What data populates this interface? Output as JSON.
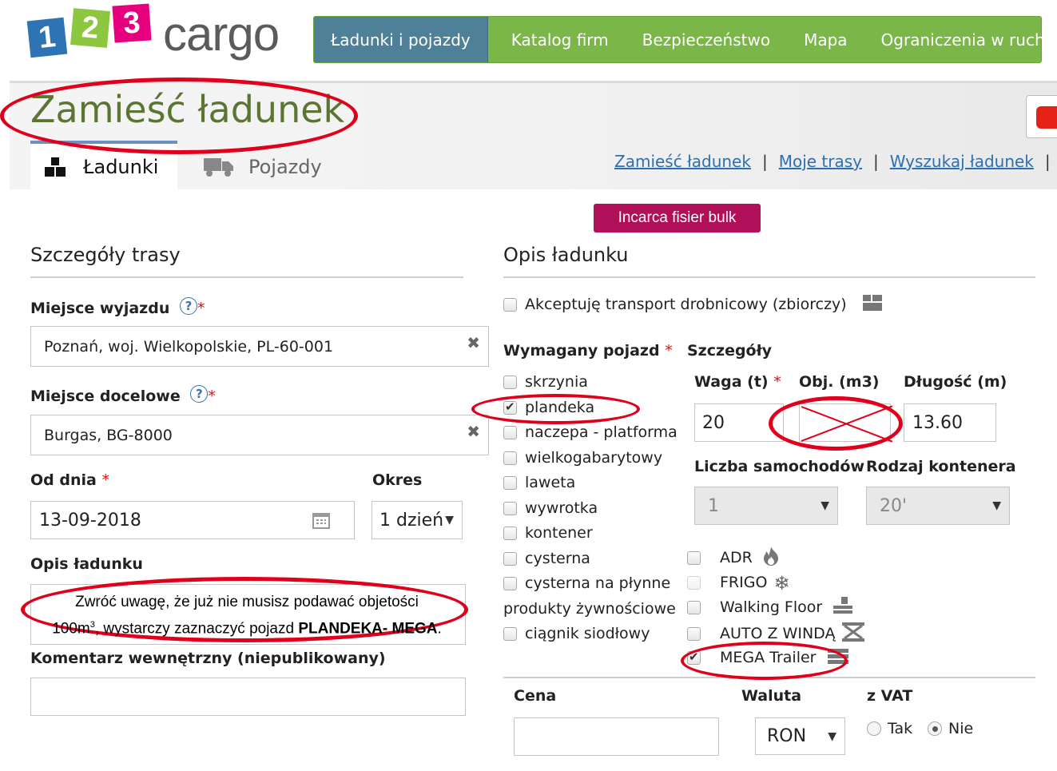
{
  "logo": {
    "digits": [
      "1",
      "2",
      "3"
    ],
    "word": "cargo",
    "colors": [
      "#2e74b5",
      "#8dc63f",
      "#e6007e"
    ]
  },
  "nav": {
    "items": [
      "Ładunki i pojazdy",
      "Katalog firm",
      "Bezpieczeństwo",
      "Mapa",
      "Ograniczenia w ruchu"
    ],
    "active_index": 0,
    "bar_color": "#7ab648",
    "active_color": "#4e8097"
  },
  "page": {
    "title": "Zamieść ładunek",
    "tabs": [
      {
        "label": "Ładunki",
        "icon": "boxes-icon",
        "active": true
      },
      {
        "label": "Pojazdy",
        "icon": "truck-icon",
        "active": false
      }
    ],
    "links": [
      "Zamieść ładunek",
      "Moje trasy",
      "Wyszukaj ładunek"
    ],
    "link_separator": "|",
    "bulk_button": "Incarca fisier bulk"
  },
  "route": {
    "title": "Szczegóły trasy",
    "from": {
      "label": "Miejsce wyjazdu",
      "value": "Poznań, woj. Wielkopolskie, PL-60-001"
    },
    "to": {
      "label": "Miejsce docelowe",
      "value": "Burgas, BG-8000"
    },
    "date": {
      "label": "Od dnia",
      "value": "13-09-2018"
    },
    "period": {
      "label": "Okres",
      "value": "1 dzień"
    },
    "description": {
      "label": "Opis ładunku",
      "value": ""
    },
    "comment": {
      "label": "Komentarz wewnętrzny (niepublikowany)",
      "value": ""
    },
    "help_glyph": "?",
    "required_mark": "*",
    "clear_glyph": "✖"
  },
  "cargo": {
    "title": "Opis ładunku",
    "groupage": {
      "label": "Akceptuję transport drobnicowy (zbiorczy)",
      "checked": false
    },
    "vehicle": {
      "label": "Wymagany pojazd",
      "types": [
        {
          "label": "skrzynia",
          "checked": false
        },
        {
          "label": "plandeka",
          "checked": true
        },
        {
          "label": "naczepa - platforma",
          "checked": false
        },
        {
          "label": "wielkogabarytowy",
          "checked": false
        },
        {
          "label": "laweta",
          "checked": false
        },
        {
          "label": "wywrotka",
          "checked": false
        },
        {
          "label": "kontener",
          "checked": false
        },
        {
          "label": "cysterna",
          "checked": false
        },
        {
          "label": "cysterna na płynne",
          "checked": false
        },
        {
          "label": "produkty żywnościowe",
          "checked": false
        },
        {
          "label": "ciągnik siodłowy",
          "checked": false
        }
      ]
    },
    "details": {
      "label": "Szczegóły",
      "weight": {
        "label": "Waga (t)",
        "value": "20"
      },
      "volume": {
        "label": "Obj. (m3)",
        "value": ""
      },
      "length": {
        "label": "Długość (m)",
        "value": "13.60"
      },
      "trucks": {
        "label": "Liczba samochodów",
        "value": "1"
      },
      "container": {
        "label": "Rodzaj kontenera",
        "value": "20'"
      }
    },
    "options": [
      {
        "label": "ADR",
        "icon": "flame-icon",
        "checked": false
      },
      {
        "label": "FRIGO",
        "icon": "snowflake-icon",
        "checked": false
      },
      {
        "label": "Walking Floor",
        "icon": "walking-floor-icon",
        "checked": false
      },
      {
        "label": "AUTO Z WINDĄ",
        "icon": "lift-icon",
        "checked": false
      },
      {
        "label": "MEGA Trailer",
        "icon": "trailer-icon",
        "checked": true
      }
    ]
  },
  "price": {
    "label": "Cena",
    "value": "",
    "currency": {
      "label": "Waluta",
      "value": "RON"
    },
    "vat": {
      "label": "z VAT",
      "options": [
        "Tak",
        "Nie"
      ],
      "selected": "Nie"
    }
  },
  "annotation": {
    "line1": "Zwróć uwagę, że już nie musisz podawać objetości",
    "line2_prefix": "100m",
    "line2_sup": "3",
    "line2_mid": ", wystarczy zaznaczyć pojazd ",
    "line2_bold": "PLANDEKA- MEGA",
    "line2_end": ".",
    "color": "#e0001b"
  }
}
